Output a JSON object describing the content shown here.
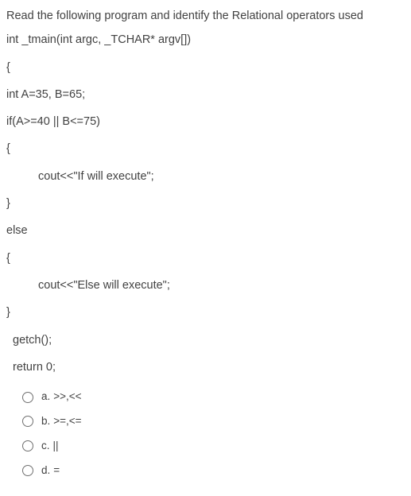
{
  "question": {
    "prompt": "Read the following program and identify the Relational operators used",
    "code_lines": [
      "int _tmain(int argc, _TCHAR* argv[])",
      "{",
      "int A=35, B=65;",
      "if(A>=40 || B<=75)",
      "{",
      "cout<<\"If will execute\";",
      "}",
      "else",
      "{",
      "cout<<\"Else will execute\";",
      "}",
      "getch();",
      "return 0;"
    ]
  },
  "options": [
    {
      "letter": "a.",
      "text": ">>,<<"
    },
    {
      "letter": "b.",
      "text": ">=,<="
    },
    {
      "letter": "c.",
      "text": "||"
    },
    {
      "letter": "d.",
      "text": "="
    }
  ]
}
